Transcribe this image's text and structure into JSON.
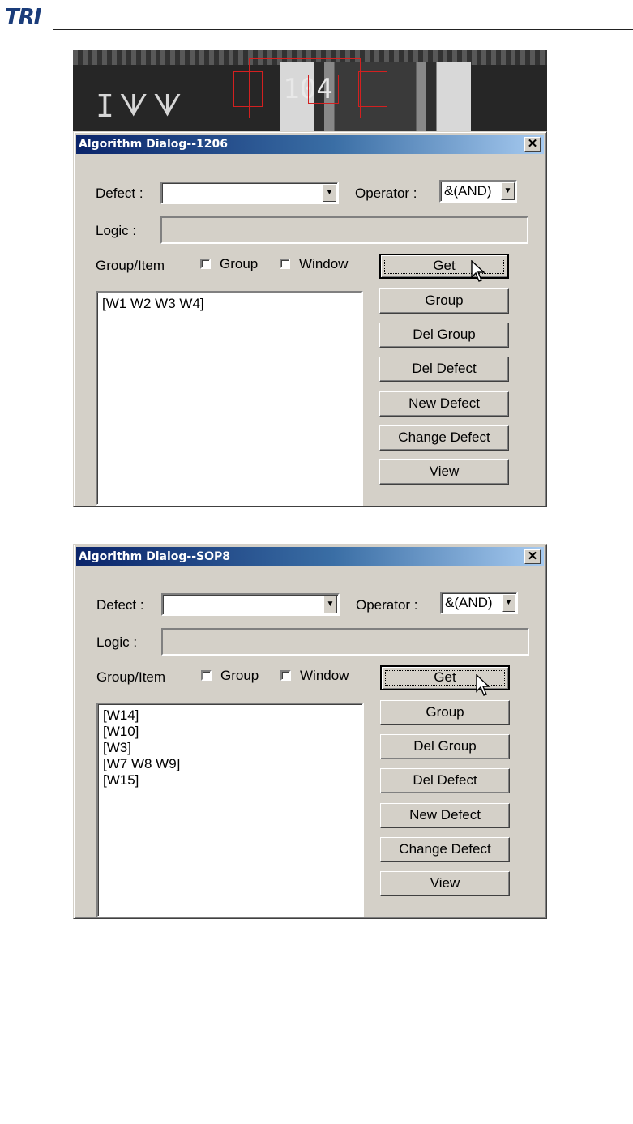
{
  "header": {
    "logo_text": "TRI"
  },
  "camera": {
    "component_marking": "104",
    "side_text": "ᗑᗑI"
  },
  "dialogs": [
    {
      "title": "Algorithm Dialog--1206",
      "close_label": "✕",
      "defect_label": "Defect :",
      "defect_value": "",
      "operator_label": "Operator :",
      "operator_value": "&(AND)",
      "logic_label": "Logic :",
      "logic_value": "",
      "group_item_label": "Group/Item",
      "group_checkbox_label": "Group",
      "window_checkbox_label": "Window",
      "items": [
        "[W1 W2 W3 W4]"
      ],
      "buttons": {
        "get": "Get",
        "group": "Group",
        "del_group": "Del Group",
        "del_defect": "Del Defect",
        "new_defect": "New Defect",
        "change_defect": "Change Defect",
        "view": "View"
      }
    },
    {
      "title": "Algorithm Dialog--SOP8",
      "close_label": "✕",
      "defect_label": "Defect :",
      "defect_value": "",
      "operator_label": "Operator :",
      "operator_value": "&(AND)",
      "logic_label": "Logic :",
      "logic_value": "",
      "group_item_label": "Group/Item",
      "group_checkbox_label": "Group",
      "window_checkbox_label": "Window",
      "items": [
        "[W14]",
        "[W10]",
        "[W3]",
        "[W7 W8 W9]",
        "[W15]"
      ],
      "buttons": {
        "get": "Get",
        "group": "Group",
        "del_group": "Del Group",
        "del_defect": "Del Defect",
        "new_defect": "New Defect",
        "change_defect": "Change Defect",
        "view": "View"
      }
    }
  ],
  "colors": {
    "title_start": "#0a246a",
    "title_end": "#a6caf0",
    "dialog_face": "#d4d0c8",
    "roi_red": "#d32020"
  }
}
